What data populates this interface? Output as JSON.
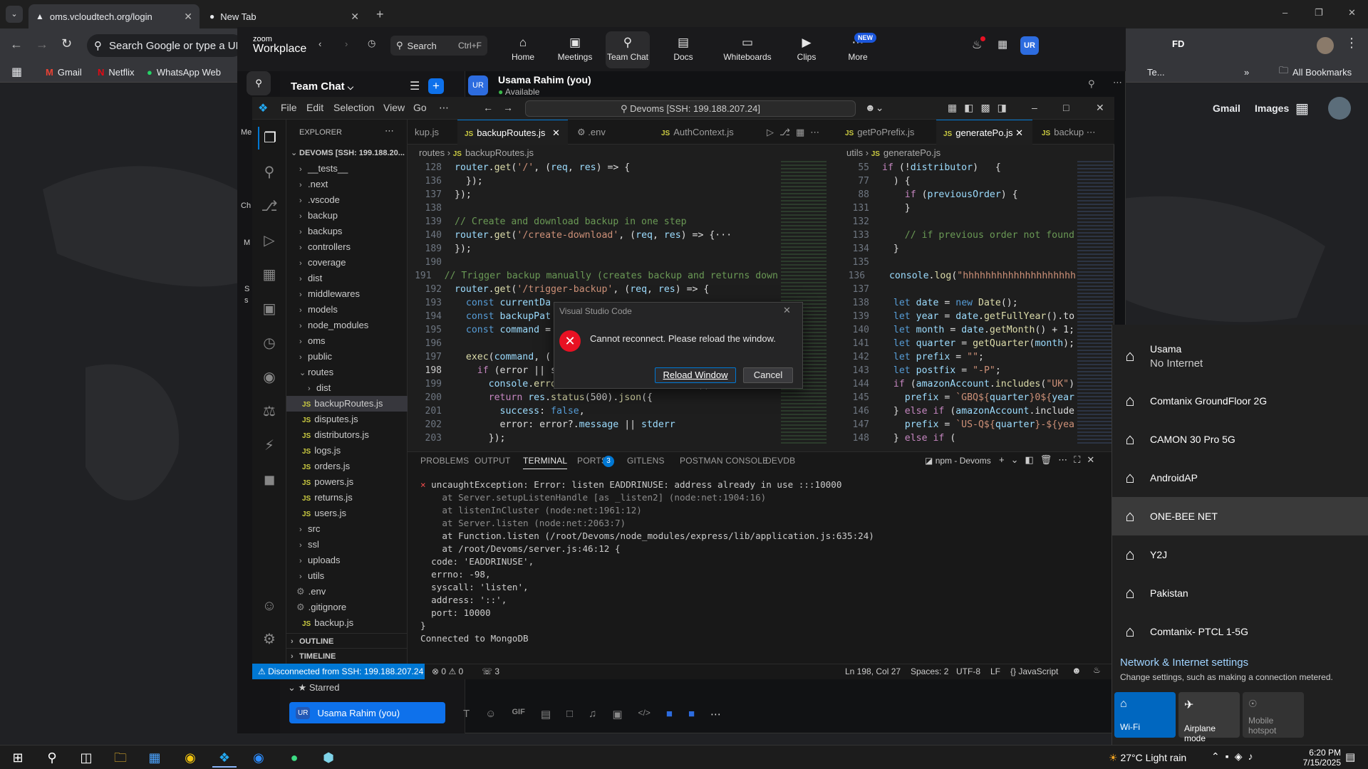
{
  "chrome": {
    "tabs": [
      {
        "title": "oms.vcloudtech.org/login"
      },
      {
        "title": "New Tab"
      }
    ],
    "omnibox_text": "Search Google or type a URL",
    "bookmarks": [
      "Gmail",
      "Netflix",
      "WhatsApp Web"
    ],
    "bookmarks_right": "All Bookmarks",
    "bookmark_partial": "Te...",
    "google_links": [
      "Gmail",
      "Images"
    ]
  },
  "zoom": {
    "brand_top": "zoom",
    "brand_bottom": "Workplace",
    "search_label": "Search",
    "search_shortcut": "Ctrl+F",
    "nav": [
      "Home",
      "Meetings",
      "Team Chat",
      "Docs",
      "Whiteboards",
      "Clips",
      "More"
    ],
    "new_badge": "NEW",
    "avatar_initials": "UR",
    "panel_title": "Team Chat",
    "user_name": "Usama Rahim (you)",
    "user_status": "Available",
    "starred_label": "Starred",
    "starred_item": "Usama Rahim (you)",
    "side_partial": [
      "Me",
      "Ch",
      "M",
      "S",
      "s"
    ]
  },
  "vscode": {
    "menu": [
      "File",
      "Edit",
      "Selection",
      "View",
      "Go"
    ],
    "search_title": "Devoms [SSH: 199.188.207.24]",
    "explorer_header": "EXPLORER",
    "root": "DEVOMS [SSH: 199.188.20...",
    "tree": [
      {
        "name": "__tests__",
        "type": "folder"
      },
      {
        "name": ".next",
        "type": "folder"
      },
      {
        "name": ".vscode",
        "type": "folder"
      },
      {
        "name": "backup",
        "type": "folder"
      },
      {
        "name": "backups",
        "type": "folder"
      },
      {
        "name": "controllers",
        "type": "folder"
      },
      {
        "name": "coverage",
        "type": "folder"
      },
      {
        "name": "dist",
        "type": "folder"
      },
      {
        "name": "middlewares",
        "type": "folder"
      },
      {
        "name": "models",
        "type": "folder"
      },
      {
        "name": "node_modules",
        "type": "folder"
      },
      {
        "name": "oms",
        "type": "folder"
      },
      {
        "name": "public",
        "type": "folder"
      },
      {
        "name": "routes",
        "type": "open"
      },
      {
        "name": "dist",
        "type": "subfolder"
      },
      {
        "name": "backupRoutes.js",
        "type": "js",
        "selected": true
      },
      {
        "name": "disputes.js",
        "type": "js"
      },
      {
        "name": "distributors.js",
        "type": "js"
      },
      {
        "name": "logs.js",
        "type": "js"
      },
      {
        "name": "orders.js",
        "type": "js"
      },
      {
        "name": "powers.js",
        "type": "js"
      },
      {
        "name": "returns.js",
        "type": "js"
      },
      {
        "name": "users.js",
        "type": "js"
      },
      {
        "name": "src",
        "type": "folder"
      },
      {
        "name": "ssl",
        "type": "folder"
      },
      {
        "name": "uploads",
        "type": "folder"
      },
      {
        "name": "utils",
        "type": "folder"
      },
      {
        "name": ".env",
        "type": "env"
      },
      {
        "name": ".gitignore",
        "type": "env"
      },
      {
        "name": "backup.js",
        "type": "js"
      }
    ],
    "outline": "OUTLINE",
    "timeline": "TIMELINE",
    "left_tabs": [
      "kup.js",
      "backupRoutes.js",
      ".env",
      "AuthContext.js"
    ],
    "right_tabs": [
      "getPoPrefix.js",
      "generatePo.js",
      "backup"
    ],
    "left_crumb": [
      "routes",
      "backupRoutes.js"
    ],
    "right_crumb": [
      "utils",
      "generatePo.js"
    ],
    "left_code": [
      {
        "n": "128",
        "t": "router.get('/', (req, res) => {"
      },
      {
        "n": "136",
        "t": "  });"
      },
      {
        "n": "137",
        "t": "});"
      },
      {
        "n": "138",
        "t": ""
      },
      {
        "n": "139",
        "t": "// Create and download backup in one step"
      },
      {
        "n": "140",
        "t": "router.get('/create-download', (req, res) => {···"
      },
      {
        "n": "189",
        "t": "});"
      },
      {
        "n": "190",
        "t": ""
      },
      {
        "n": "191",
        "t": "// Trigger backup manually (creates backup and returns down"
      },
      {
        "n": "192",
        "t": "router.get('/trigger-backup', (req, res) => {"
      },
      {
        "n": "193",
        "t": "  const currentDa"
      },
      {
        "n": "194",
        "t": "  const backupPat"
      },
      {
        "n": "195",
        "t": "  const command ="
      },
      {
        "n": "196",
        "t": ""
      },
      {
        "n": "197",
        "t": "  exec(command, ("
      },
      {
        "n": "198",
        "t": "    if (error || s"
      },
      {
        "n": "199",
        "t": "      console.error('Backup error:', error || stderr);"
      },
      {
        "n": "200",
        "t": "      return res.status(500).json({"
      },
      {
        "n": "201",
        "t": "        success: false,"
      },
      {
        "n": "202",
        "t": "        error: error?.message || stderr"
      },
      {
        "n": "203",
        "t": "      });"
      }
    ],
    "right_code": [
      {
        "n": "55",
        "t": "if (!distributor)   {"
      },
      {
        "n": "77",
        "t": "  ) {"
      },
      {
        "n": "88",
        "t": "    if (previousOrder) {"
      },
      {
        "n": "131",
        "t": "    }"
      },
      {
        "n": "132",
        "t": ""
      },
      {
        "n": "133",
        "t": "    // if previous order not found"
      },
      {
        "n": "134",
        "t": "  }"
      },
      {
        "n": "135",
        "t": ""
      },
      {
        "n": "136",
        "t": "  console.log(\"hhhhhhhhhhhhhhhhhhhh"
      },
      {
        "n": "137",
        "t": ""
      },
      {
        "n": "138",
        "t": "  let date = new Date();"
      },
      {
        "n": "139",
        "t": "  let year = date.getFullYear().to"
      },
      {
        "n": "140",
        "t": "  let month = date.getMonth() + 1;"
      },
      {
        "n": "141",
        "t": "  let quarter = getQuarter(month);"
      },
      {
        "n": "142",
        "t": "  let prefix = \"\";"
      },
      {
        "n": "143",
        "t": "  let postfix = \"-P\";"
      },
      {
        "n": "144",
        "t": "  if (amazonAccount.includes(\"UK\")"
      },
      {
        "n": "145",
        "t": "    prefix = `GBQ${quarter}0${year"
      },
      {
        "n": "146",
        "t": "  } else if (amazonAccount.include"
      },
      {
        "n": "147",
        "t": "    prefix = `US-Q${quarter}-${yea"
      },
      {
        "n": "148",
        "t": "  } else if ("
      }
    ],
    "panel_tabs": [
      "PROBLEMS",
      "OUTPUT",
      "TERMINAL",
      "PORTS",
      "GITLENS",
      "POSTMAN CONSOLE",
      "DEVDB"
    ],
    "ports_count": "3",
    "terminal_name": "npm - Devoms",
    "terminal": [
      {
        "t": "uncaughtException: Error: listen EADDRINUSE: address already in use :::10000",
        "c": "err"
      },
      {
        "t": "    at Server.setupListenHandle [as _listen2] (node:net:1904:16)",
        "c": "dim"
      },
      {
        "t": "    at listenInCluster (node:net:1961:12)",
        "c": "dim"
      },
      {
        "t": "    at Server.listen (node:net:2063:7)",
        "c": "dim"
      },
      {
        "t": "    at Function.listen (/root/Devoms/node_modules/express/lib/application.js:635:24)",
        "c": ""
      },
      {
        "t": "    at /root/Devoms/server.js:46:12 {",
        "c": ""
      },
      {
        "t": "  code: 'EADDRINUSE',",
        "c": ""
      },
      {
        "t": "  errno: -98,",
        "c": ""
      },
      {
        "t": "  syscall: 'listen',",
        "c": ""
      },
      {
        "t": "  address: '::',",
        "c": ""
      },
      {
        "t": "  port: 10000",
        "c": ""
      },
      {
        "t": "}",
        "c": ""
      },
      {
        "t": "Connected to MongoDB",
        "c": ""
      }
    ],
    "status": {
      "remote": "Disconnected from SSH: 199.188.207.24",
      "errors": "0",
      "warnings": "0",
      "ports": "3",
      "position": "Ln 198, Col 27",
      "spaces": "Spaces: 2",
      "encoding": "UTF-8",
      "eol": "LF",
      "language": "JavaScript"
    },
    "dialog": {
      "title": "Visual Studio Code",
      "message": "Cannot reconnect. Please reload the window.",
      "primary": "Reload Window",
      "secondary": "Cancel"
    }
  },
  "wifi": {
    "connected_name": "Usama",
    "connected_status": "No Internet",
    "networks": [
      "Comtanix GroundFloor 2G",
      "CAMON 30 Pro 5G",
      "AndroidAP",
      "ONE-BEE NET",
      "Y2J",
      "Pakistan",
      "Comtanix- PTCL 1-5G"
    ],
    "settings_title": "Network & Internet settings",
    "settings_sub": "Change settings, such as making a connection metered.",
    "quick": [
      {
        "label": "Wi-Fi",
        "active": true
      },
      {
        "label": "Airplane mode",
        "active": false
      },
      {
        "label": "Mobile hotspot",
        "active": false
      }
    ]
  },
  "taskbar": {
    "weather": "27°C  Light rain",
    "time": "6:20 PM",
    "date": "7/15/2025"
  },
  "colors": {
    "accent": "#0078d4",
    "error": "#e81123",
    "vscode_bg": "#1e1e1e"
  }
}
